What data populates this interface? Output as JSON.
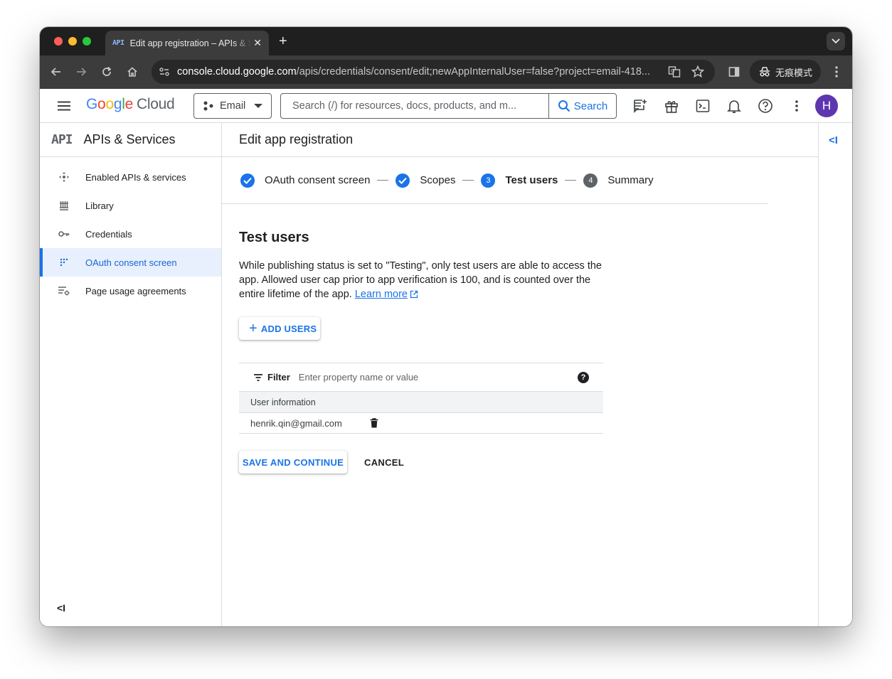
{
  "browser": {
    "tab_favicon": "API",
    "tab_title": "Edit app registration – APIs & Services",
    "url_host": "console.cloud.google.com",
    "url_path": "/apis/credentials/consent/edit;newAppInternalUser=false?project=email-418...",
    "incognito_label": "无痕模式"
  },
  "header": {
    "logo_g1": "G",
    "logo_o1": "o",
    "logo_o2": "o",
    "logo_g2": "g",
    "logo_l": "l",
    "logo_e": "e",
    "logo_cloud": "Cloud",
    "project": "Email",
    "search_placeholder": "Search (/) for resources, docs, products, and m...",
    "search_button": "Search",
    "avatar_initial": "H"
  },
  "sidebar": {
    "badge": "API",
    "title": "APIs & Services",
    "items": [
      {
        "label": "Enabled APIs & services",
        "icon": "hub-icon"
      },
      {
        "label": "Library",
        "icon": "library-icon"
      },
      {
        "label": "Credentials",
        "icon": "key-icon"
      },
      {
        "label": "OAuth consent screen",
        "icon": "dots-grid-icon",
        "active": true
      },
      {
        "label": "Page usage agreements",
        "icon": "settings-list-icon"
      }
    ],
    "collapse_label": "<I"
  },
  "main": {
    "page_title": "Edit app registration",
    "steps": [
      {
        "label": "OAuth consent screen",
        "state": "done"
      },
      {
        "label": "Scopes",
        "state": "done"
      },
      {
        "number": "3",
        "label": "Test users",
        "state": "current"
      },
      {
        "number": "4",
        "label": "Summary",
        "state": "todo"
      }
    ],
    "section_title": "Test users",
    "description": "While publishing status is set to \"Testing\", only test users are able to access the app. Allowed user cap prior to app verification is 100, and is counted over the entire lifetime of the app.",
    "learn_more": "Learn more",
    "add_users": "ADD USERS",
    "filter_label": "Filter",
    "filter_placeholder": "Enter property name or value",
    "help_glyph": "?",
    "table": {
      "column": "User information",
      "rows": [
        {
          "email": "henrik.qin@gmail.com"
        }
      ]
    },
    "save_button": "SAVE AND CONTINUE",
    "cancel_button": "CANCEL"
  },
  "right_rail": {
    "toggle_label": "<I"
  },
  "colors": {
    "accent": "#1a73e8",
    "avatar": "#5e35b1"
  }
}
